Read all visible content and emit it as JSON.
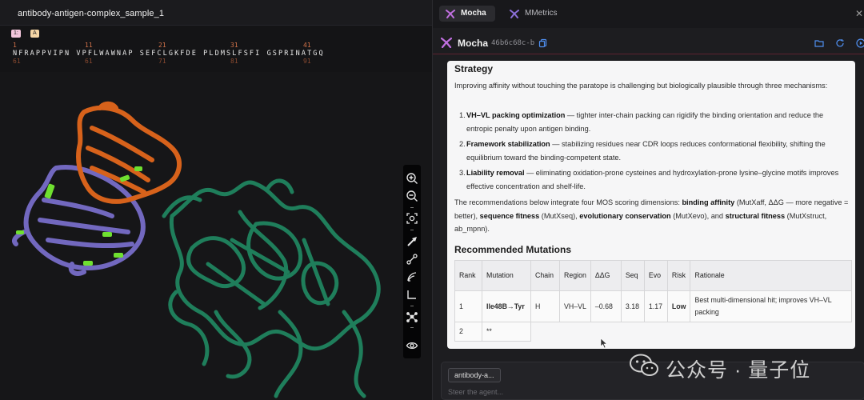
{
  "viewer": {
    "title": "antibody-antigen-complex_sample_1",
    "chain_chips": [
      "1:",
      "A"
    ],
    "ticks": [
      "1",
      "11",
      "21",
      "31",
      "41"
    ],
    "sequence": "NFRAPPVIPN VPFLWAWNAP SEFCLGKFDE PLDMSLFSFI GSPRINATGQ",
    "sub_ticks": [
      "61",
      "61",
      "71",
      "81",
      "91"
    ],
    "colors": {
      "heavy_chain": "#d7621b",
      "light_chain": "#7268bf",
      "antigen": "#1f7e5b",
      "highlight": "#6fe030"
    },
    "toolbar_icons": [
      "zoom-in-icon",
      "zoom-out-icon",
      "focus-icon",
      "pointer-icon",
      "measure-icon",
      "wave-icon",
      "corner-icon",
      "network-icon",
      "eye-icon"
    ]
  },
  "tabs": [
    {
      "label": "Mocha",
      "active": true
    },
    {
      "label": "MMetrics",
      "active": false
    }
  ],
  "agent": {
    "name": "Mocha",
    "session_id": "46b6c68c-b",
    "header_icons": [
      "folder-icon",
      "refresh-icon",
      "play-icon"
    ]
  },
  "content": {
    "strategy_heading": "Strategy",
    "strategy_intro": "Improving affinity without touching the paratope is challenging but biologically plausible through three mechanisms:",
    "mechanisms": [
      {
        "num": "1.",
        "title": "VH–VL packing optimization",
        "text": " — tighter inter-chain packing can rigidify the binding orientation and reduce the entropic penalty upon antigen binding."
      },
      {
        "num": "2.",
        "title": "Framework stabilization",
        "text": " — stabilizing residues near CDR loops reduces conformational flexibility, shifting the equilibrium toward the binding-competent state."
      },
      {
        "num": "3.",
        "title": "Liability removal",
        "text": " — eliminating oxidation-prone cysteines and hydroxylation-prone lysine–glycine motifs improves effective concentration and shelf-life."
      }
    ],
    "recommend_parts": [
      {
        "bold": false,
        "text": "The recommendations below integrate four MOS scoring dimensions: "
      },
      {
        "bold": true,
        "text": "binding affinity"
      },
      {
        "bold": false,
        "text": " (MutXaff, ΔΔG — more negative = better), "
      },
      {
        "bold": true,
        "text": "sequence fitness"
      },
      {
        "bold": false,
        "text": " (MutXseq), "
      },
      {
        "bold": true,
        "text": "evolutionary conservation"
      },
      {
        "bold": false,
        "text": " (MutXevo), and "
      },
      {
        "bold": true,
        "text": "structural fitness"
      },
      {
        "bold": false,
        "text": " (MutXstruct, ab_mpnn)."
      }
    ],
    "recommended_heading": "Recommended Mutations",
    "table": {
      "headers": [
        "Rank",
        "Mutation",
        "Chain",
        "Region",
        "ΔΔG",
        "Seq",
        "Evo",
        "Risk",
        "Rationale"
      ],
      "rows": [
        [
          "1",
          "Ile48B→Tyr",
          "H",
          "VH–VL",
          "–0.68",
          "3.18",
          "1.17",
          "Low",
          "Best multi-dimensional hit; improves VH–VL packing"
        ],
        [
          "2",
          "**"
        ]
      ]
    }
  },
  "input": {
    "context_chip": "antibody-a...",
    "placeholder": "Steer the agent..."
  },
  "watermark": {
    "text": "公众号 · 量子位"
  }
}
